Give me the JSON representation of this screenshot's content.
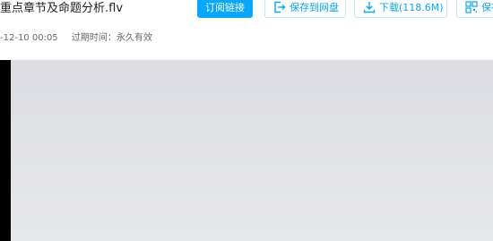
{
  "file": {
    "title": "重点章节及命题分析.flv",
    "shared_time": "-12-10 00:05",
    "expire_text": "过期时间：永久有效"
  },
  "toolbar": {
    "subscribe_label": "订阅链接",
    "save_label": "保存到网盘",
    "download_label": "下载(118.6M)",
    "qr_label": "保存"
  },
  "icons": {
    "save": "save-to-disk-icon",
    "download": "download-icon",
    "qr": "qr-code-icon"
  },
  "colors": {
    "accent": "#06a7ff",
    "outline_border": "#c3e7fb",
    "player_bg": "#000000",
    "video_surface": "#e0e1e5"
  }
}
